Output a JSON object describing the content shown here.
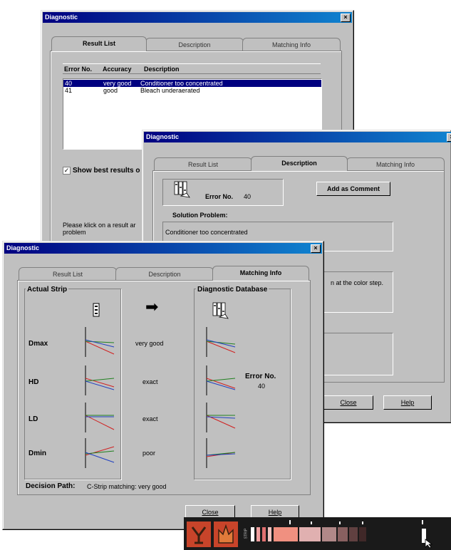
{
  "win1": {
    "title": "Diagnostic",
    "close_glyph": "×",
    "tabs": [
      "Result List",
      "Description",
      "Matching Info"
    ],
    "columns": [
      "Error No.",
      "Accuracy",
      "Description"
    ],
    "rows": [
      {
        "no": "40",
        "acc": "very good",
        "desc": "Conditioner too concentrated",
        "selected": true
      },
      {
        "no": "41",
        "acc": "good",
        "desc": "Bleach underaerated",
        "selected": false
      }
    ],
    "checkbox_label": "Show best results o",
    "checkbox_mark": "✓",
    "hint": "Please klick on a result ar",
    "hint2": "problem"
  },
  "win2": {
    "title": "Diagnostic",
    "close_glyph": "×",
    "tabs": [
      "Result List",
      "Description",
      "Matching Info"
    ],
    "error_label": "Error No.",
    "error_value": "40",
    "add_comment": "Add as Comment",
    "solution_label": "Solution Problem:",
    "solution_text": "Conditioner too concentrated",
    "cause_text": "n at the color step.",
    "close_button": "Close",
    "help_button": "Help"
  },
  "win3": {
    "title": "Diagnostic",
    "close_glyph": "×",
    "tabs": [
      "Result List",
      "Description",
      "Matching Info"
    ],
    "actual_strip_label": "Actual Strip",
    "database_label": "Diagnostic Database",
    "arrow_glyph": "➡",
    "metrics": [
      {
        "name": "Dmax",
        "match": "very good"
      },
      {
        "name": "HD",
        "match": "exact"
      },
      {
        "name": "LD",
        "match": "exact"
      },
      {
        "name": "Dmin",
        "match": "poor"
      }
    ],
    "error_label": "Error No.",
    "error_value": "40",
    "decision_label": "Decision Path:",
    "decision_text": "C-Strip matching: very good",
    "close_button": "Close",
    "help_button": "Help"
  },
  "strip": {
    "side_text": "STRIP",
    "bg_color": "#1a1a1a",
    "logo_color": "#c8442a"
  }
}
